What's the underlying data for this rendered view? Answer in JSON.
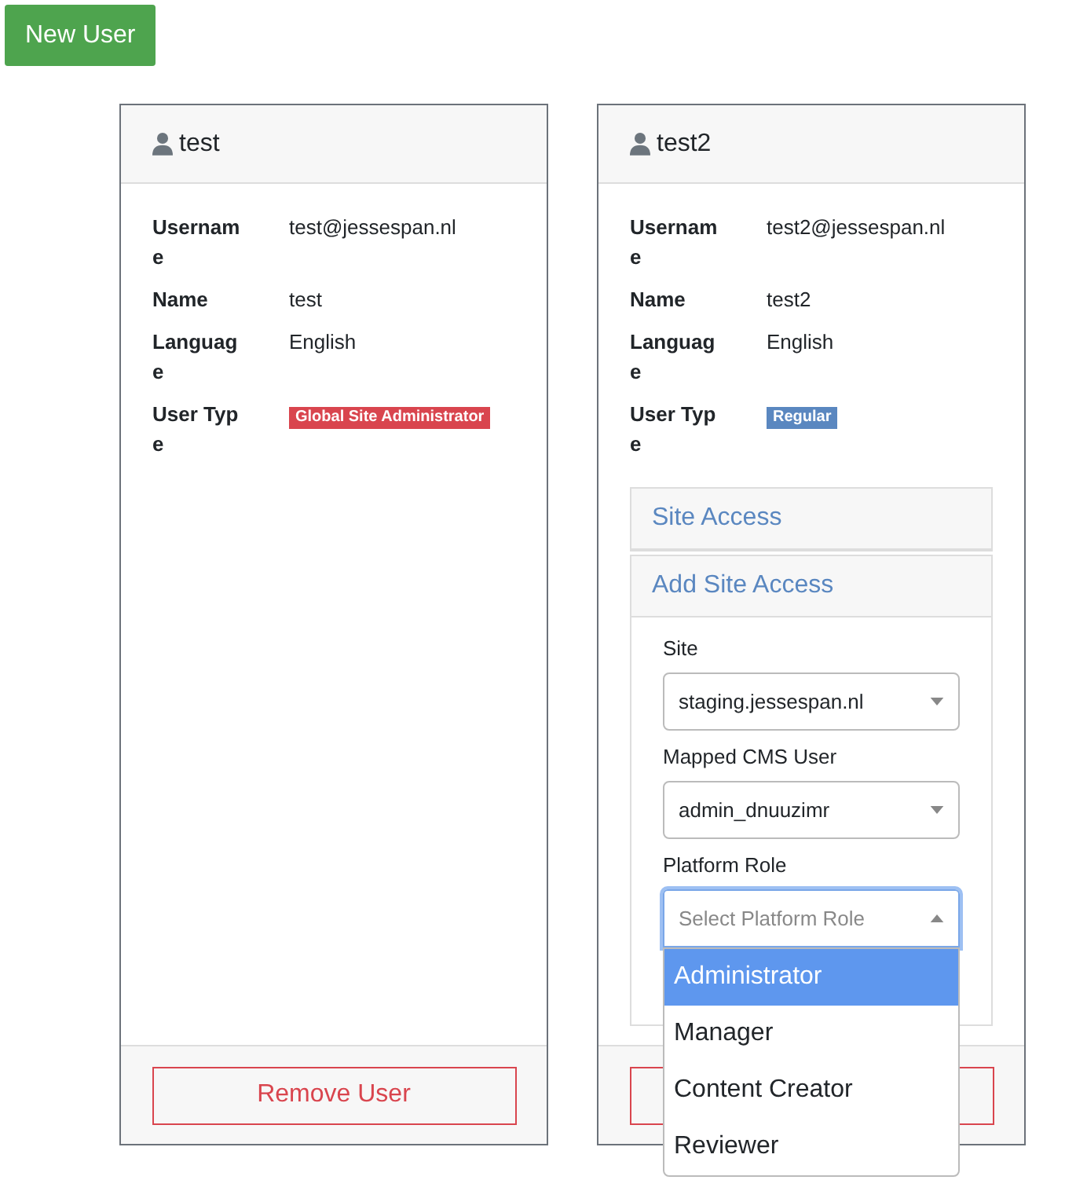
{
  "new_user_button": "New User",
  "cards": [
    {
      "title": "test",
      "details": [
        {
          "label": "Username",
          "value": "test@jessespan.nl",
          "kind": "text"
        },
        {
          "label": "Name",
          "value": "test",
          "kind": "text"
        },
        {
          "label": "Language",
          "value": "English",
          "kind": "text"
        },
        {
          "label": "User Type",
          "value": "Global Site Administrator",
          "kind": "badge",
          "color": "#d9454e"
        }
      ],
      "footer": {
        "kind": "remove_button",
        "label": "Remove User"
      }
    },
    {
      "title": "test2",
      "details": [
        {
          "label": "Username",
          "value": "test2@jessespan.nl",
          "kind": "text"
        },
        {
          "label": "Name",
          "value": "test2",
          "kind": "text"
        },
        {
          "label": "Language",
          "value": "English",
          "kind": "text"
        },
        {
          "label": "User Type",
          "value": "Regular",
          "kind": "badge",
          "color": "#5a87c0"
        }
      ],
      "panels": [
        {
          "title": "Site Access",
          "expanded": false
        },
        {
          "title": "Add Site Access",
          "expanded": true,
          "fields": [
            {
              "label": "Site",
              "value": "staging.jessespan.nl",
              "open": false
            },
            {
              "label": "Mapped CMS User",
              "value": "admin_dnuuzimr",
              "open": false
            },
            {
              "label": "Platform Role",
              "placeholder": "Select Platform Role",
              "open": true,
              "options": [
                {
                  "label": "Administrator",
                  "selected": true
                },
                {
                  "label": "Manager",
                  "selected": false
                },
                {
                  "label": "Content Creator",
                  "selected": false
                },
                {
                  "label": "Reviewer",
                  "selected": false
                }
              ]
            }
          ]
        }
      ],
      "footer": {
        "kind": "remove_button"
      }
    }
  ]
}
